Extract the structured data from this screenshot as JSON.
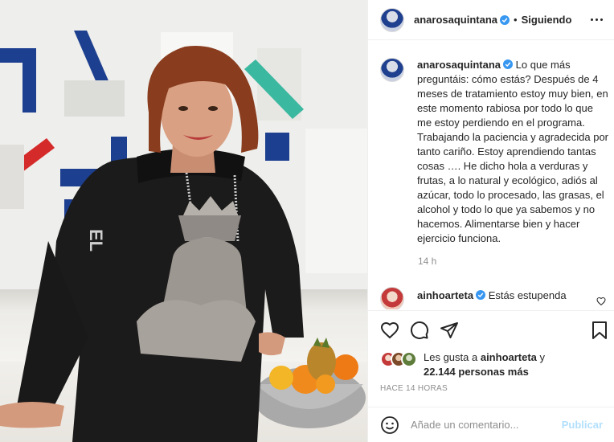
{
  "post": {
    "username": "anarosaquintana",
    "follow_status": "Siguiendo",
    "separator": "•",
    "caption": "Lo que más preguntáis: cómo estás? Después de 4 meses de tratamiento estoy muy bien, en este momento rabiosa por todo lo que me estoy perdiendo en el programa. Trabajando la paciencia y agradecida por tanto cariño. Estoy aprendiendo tantas cosas …. He dicho hola a verduras y frutas, a lo natural y ecológico, adiós al azúcar, todo lo procesado, las grasas, el alcohol y todo lo que ya sabemos y no hacemos. Alimentarse bien y hacer ejercicio funciona.",
    "caption_time": "14 h",
    "posted_ago": "HACE 14 HORAS"
  },
  "comments": [
    {
      "username": "ainhoarteta",
      "text": "Estás estupenda"
    }
  ],
  "likes": {
    "prefix": "Les gusta a",
    "liker": "ainhoarteta",
    "conjunction": "y",
    "others": "22.144 personas más"
  },
  "add_comment": {
    "placeholder": "Añade un comentario...",
    "submit_label": "Publicar"
  },
  "icons": {
    "header": [
      "verified-badge-icon",
      "more-options-icon"
    ],
    "actions": [
      "heart-icon",
      "comment-icon",
      "share-icon",
      "bookmark-icon"
    ],
    "comment_box": [
      "emoji-icon"
    ]
  },
  "colors": {
    "verified": "#3897f0",
    "text": "#262626",
    "muted": "#8e8e8e",
    "publish_disabled": "#b2dffc",
    "divider": "#efefef"
  }
}
